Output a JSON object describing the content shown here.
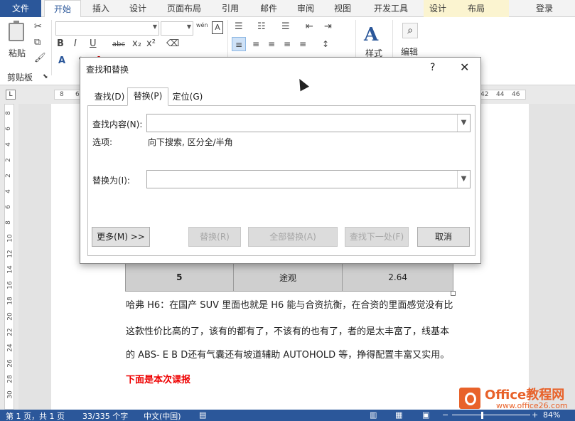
{
  "ribbon_tabs": {
    "file": "文件",
    "home": "开始",
    "insert": "插入",
    "design": "设计",
    "layout": "页面布局",
    "references": "引用",
    "mailings": "邮件",
    "review": "审阅",
    "view": "视图",
    "developer": "开发工具",
    "table_design": "设计",
    "table_layout": "布局",
    "login": "登录"
  },
  "ribbon": {
    "paste": "粘贴",
    "clipboard_group": "剪贴板",
    "phonetic": "wén",
    "char_border": "A",
    "bold": "B",
    "italic": "I",
    "underline": "U",
    "strike": "abc",
    "subscript": "x₂",
    "superscript": "x²",
    "styles": "样式",
    "editing": "编辑",
    "accent_color": "#2b579a"
  },
  "ruler_h": [
    "8",
    "6",
    "42",
    "44",
    "46"
  ],
  "ruler_v": [
    "8",
    "6",
    "4",
    "2",
    "2",
    "4",
    "6",
    "8",
    "10",
    "12",
    "14",
    "16",
    "18",
    "20",
    "22",
    "24",
    "26",
    "28",
    "30"
  ],
  "dialog": {
    "title": "查找和替换",
    "help": "?",
    "close": "✕",
    "tabs": {
      "find": "查找(D)",
      "replace": "替换(P)",
      "goto": "定位(G)"
    },
    "find_label": "查找内容(N):",
    "find_value": "",
    "options_label": "选项:",
    "options_value": "向下搜索, 区分全/半角",
    "replace_label": "替换为(I):",
    "replace_value": "",
    "buttons": {
      "more": "更多(M) >>",
      "replace": "替换(R)",
      "replace_all": "全部替换(A)",
      "find_next": "查找下一处(F)",
      "cancel": "取消"
    }
  },
  "document": {
    "table_row": [
      "5",
      "途观",
      "2.64"
    ],
    "paragraphs": [
      "哈弗 H6：在国产 SUV 里面也就是 H6 能与合资抗衡，在合资的里面感觉没有比",
      "这款性价比高的了，该有的都有了，不该有的也有了，者的是太丰富了，线基本",
      "的 ABS- E B D还有气囊还有坡道辅助 AUTOHOLD 等，挣得配置丰富又实用。",
      "下面是本次课报"
    ]
  },
  "statusbar": {
    "page": "第 1 页，共 1 页",
    "words": "33/335 个字",
    "language": "中文(中国)",
    "zoom": "84%"
  },
  "watermark": {
    "title": "Office教程网",
    "url": "www.office26.com"
  }
}
